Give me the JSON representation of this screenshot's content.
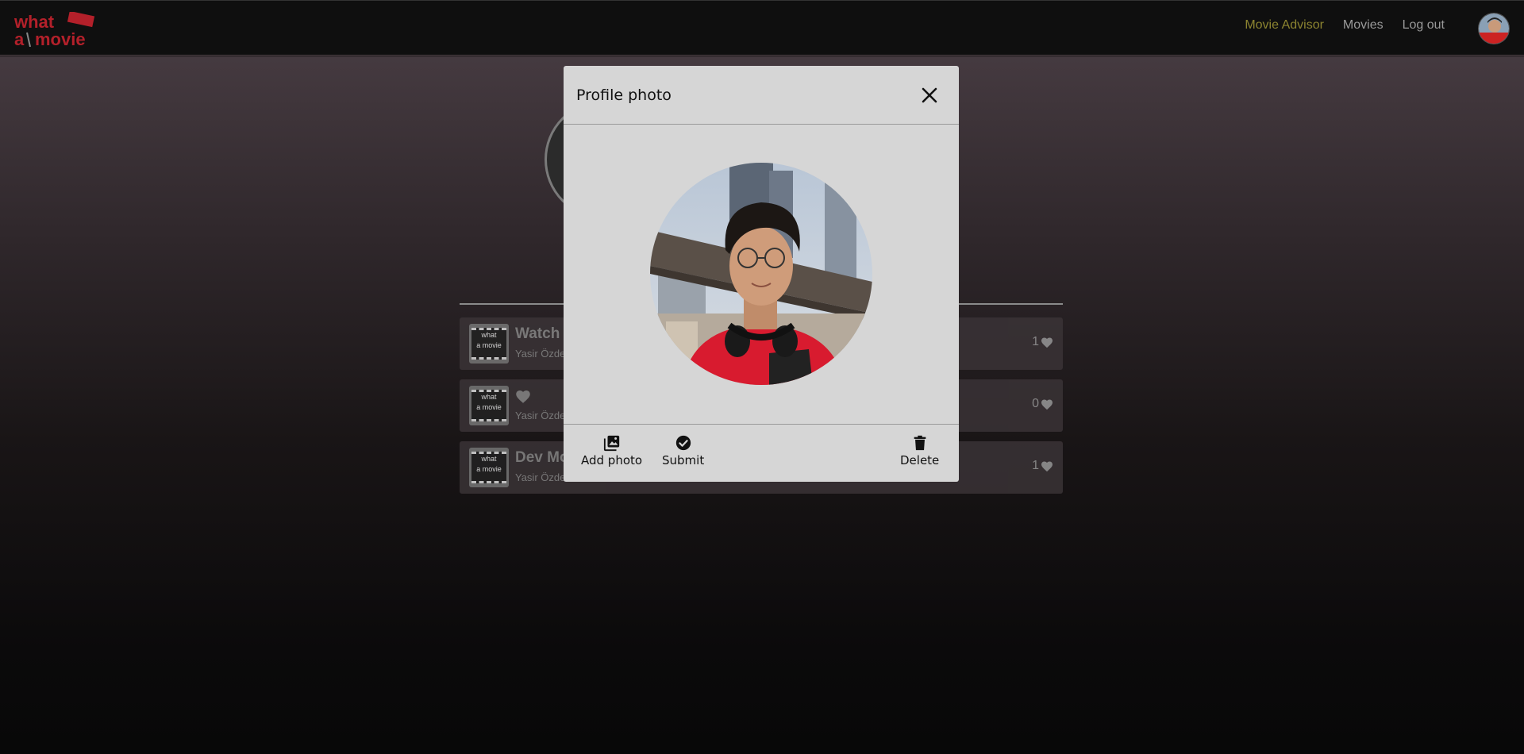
{
  "nav": {
    "logo_line1": "what",
    "logo_line2": "a movie",
    "links": [
      {
        "label": "Movie Advisor",
        "active": true
      },
      {
        "label": "Movies",
        "active": false
      },
      {
        "label": "Log out",
        "active": false
      }
    ],
    "avatar_icon": "user-avatar-photo"
  },
  "colors": {
    "navbar_bg": "#0f0f0f",
    "logo_red": "#b3202a",
    "active_link": "#8c8430",
    "modal_bg": "#d6d6d6"
  },
  "lists": [
    {
      "title": "Watch",
      "author": "Yasir Özde",
      "likes": "1",
      "title_icon": ""
    },
    {
      "title": "",
      "author": "Yasir Özde",
      "likes": "0",
      "title_icon": "heart-icon"
    },
    {
      "title": "Dev Mo",
      "author": "Yasir Özde",
      "likes": "1",
      "title_icon": ""
    }
  ],
  "thumb_text": {
    "line1": "what",
    "line2": "a movie"
  },
  "modal": {
    "title": "Profile photo",
    "actions": {
      "add_photo": "Add photo",
      "submit": "Submit",
      "delete": "Delete"
    }
  }
}
